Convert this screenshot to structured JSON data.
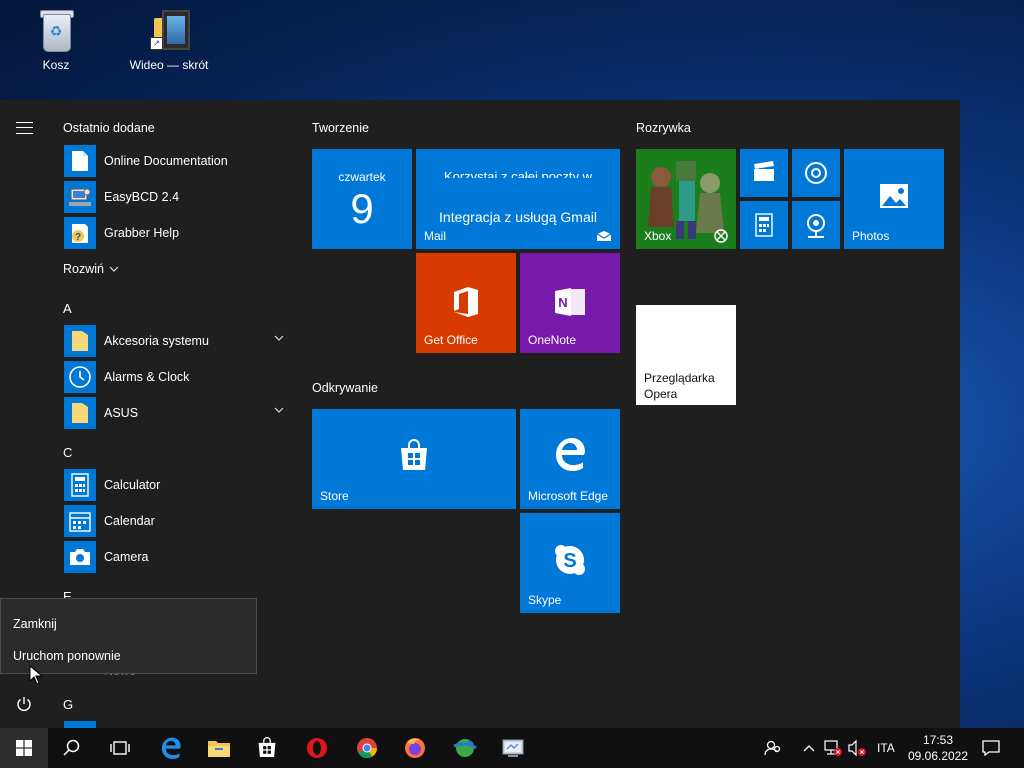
{
  "desktop": {
    "icons": [
      {
        "label": "Kosz",
        "icon": "recycle-bin-icon"
      },
      {
        "label": "Wideo — skrót",
        "icon": "video-folder-shortcut-icon"
      }
    ]
  },
  "start_menu": {
    "recent_title": "Ostatnio dodane",
    "recent_apps": [
      {
        "label": "Online Documentation",
        "icon": "document-icon"
      },
      {
        "label": "EasyBCD 2.4",
        "icon": "easybcd-icon"
      },
      {
        "label": "Grabber Help",
        "icon": "help-icon"
      }
    ],
    "expand_label": "Rozwiń",
    "letters": [
      "A",
      "C",
      "E",
      "G"
    ],
    "apps_a": [
      {
        "label": "Akcesoria systemu",
        "icon": "folder-icon",
        "has_chevron": true
      },
      {
        "label": "Alarms & Clock",
        "icon": "clock-icon"
      },
      {
        "label": "ASUS",
        "icon": "folder-icon",
        "has_chevron": true
      }
    ],
    "apps_c": [
      {
        "label": "Calculator",
        "icon": "calculator-icon"
      },
      {
        "label": "Calendar",
        "icon": "calendar-icon"
      },
      {
        "label": "Camera",
        "icon": "camera-icon"
      }
    ],
    "partial_app_label": "Nowe",
    "groups": {
      "tworzenie": "Tworzenie",
      "odkrywanie": "Odkrywanie",
      "rozrywka": "Rozrywka"
    },
    "tiles": {
      "calendar": {
        "day": "czwartek",
        "date": "9"
      },
      "mail": {
        "label": "Mail",
        "line1": "Korzystaj z całej poczty w",
        "line2": "Integracja z usługą Gmail"
      },
      "get_office": {
        "label": "Get Office",
        "color": "#d83b01"
      },
      "onenote": {
        "label": "OneNote",
        "color": "#7719aa"
      },
      "store": {
        "label": "Store"
      },
      "edge": {
        "label": "Microsoft Edge"
      },
      "skype": {
        "label": "Skype"
      },
      "xbox": {
        "label": "Xbox",
        "color": "#107c10"
      },
      "photos": {
        "label": "Photos"
      },
      "opera": {
        "label": "Przeglądarka Opera",
        "line1": "Przeglądarka",
        "line2": "Opera",
        "color": "#ffffff"
      }
    }
  },
  "power_menu": {
    "items": [
      "Zamknij",
      "Uruchom ponownie"
    ]
  },
  "taskbar": {
    "pinned": [
      "edge-icon",
      "file-explorer-icon",
      "store-icon",
      "opera-icon",
      "chrome-icon",
      "firefox-icon",
      "network-globe-icon",
      "control-panel-icon"
    ],
    "language": "ITA",
    "time": "17:53",
    "date": "09.06.2022"
  },
  "colors": {
    "accent": "#0078d7",
    "menu_bg": "#1f1f1f",
    "taskbar_bg": "#101010"
  }
}
